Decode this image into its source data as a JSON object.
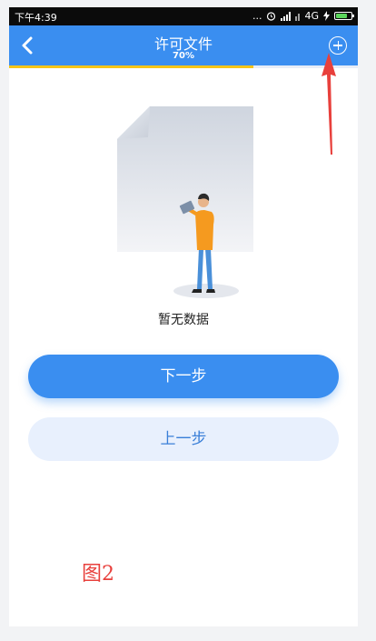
{
  "status_bar": {
    "time": "下午4:39",
    "dots": "...",
    "network": "4G",
    "alarm_icon": "alarm-clock-icon",
    "signal_icon": "signal-bars-icon",
    "charging_icon": "lightning-icon",
    "battery_icon": "battery-icon"
  },
  "header": {
    "title": "许可文件",
    "subtitle": "70%",
    "back_icon": "chevron-left-icon",
    "add_icon": "plus-circle-icon",
    "color": "#3a8ef0"
  },
  "progress": {
    "value": 0.7,
    "color": "#f5c518"
  },
  "empty_state": {
    "message": "暂无数据",
    "illustration": "person-reading-document-illustration"
  },
  "actions": {
    "next_label": "下一步",
    "prev_label": "上一步"
  },
  "annotation": {
    "label": "图2",
    "arrow_color": "#e8403c"
  }
}
